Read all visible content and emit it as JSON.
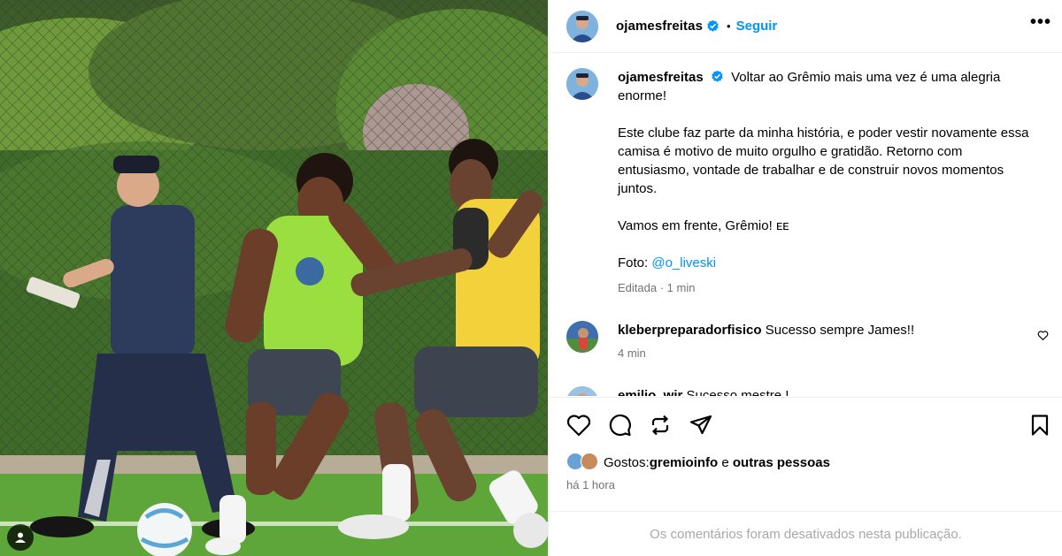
{
  "post": {
    "username": "ojamesfreitas",
    "follow_label": "Seguir",
    "more_label": "•••",
    "separator": "•"
  },
  "caption": {
    "username": "ojamesfreitas",
    "line1": "Voltar ao Grêmio mais uma vez é uma alegria enorme!",
    "line2": "Este clube faz parte da minha história, e poder vestir novamente essa camisa é motivo de muito orgulho e gratidão. Retorno com entusiasmo, vontade de trabalhar e de construir novos momentos juntos.",
    "line3": "Vamos em frente, Grêmio! ᴇᴇ",
    "photo_prefix": "Foto: ",
    "photo_mention": "@o_liveski",
    "edited": "Editada · 1 min"
  },
  "comments": [
    {
      "username": "kleberpreparadorfisico",
      "text": "Sucesso sempre James!!",
      "time": "4 min"
    },
    {
      "username": "emilio_wir",
      "text": "Sucesso mestre !",
      "time": ""
    }
  ],
  "likes": {
    "prefix": "Gostos: ",
    "user": "gremioinfo",
    "middle": " e ",
    "others": "outras pessoas"
  },
  "posted_ago": "há 1 hora",
  "footer_note": "Os comentários foram desativados nesta publicação.",
  "icons": {
    "like": "heart-icon",
    "comment": "comment-icon",
    "repost": "repost-icon",
    "share": "send-icon",
    "save": "bookmark-icon",
    "verified": "verified-badge-icon",
    "user_tag": "user-tag-icon"
  },
  "colors": {
    "link": "#0095f6",
    "muted": "#737373",
    "border": "#efefef",
    "verified": "#0095f6"
  }
}
